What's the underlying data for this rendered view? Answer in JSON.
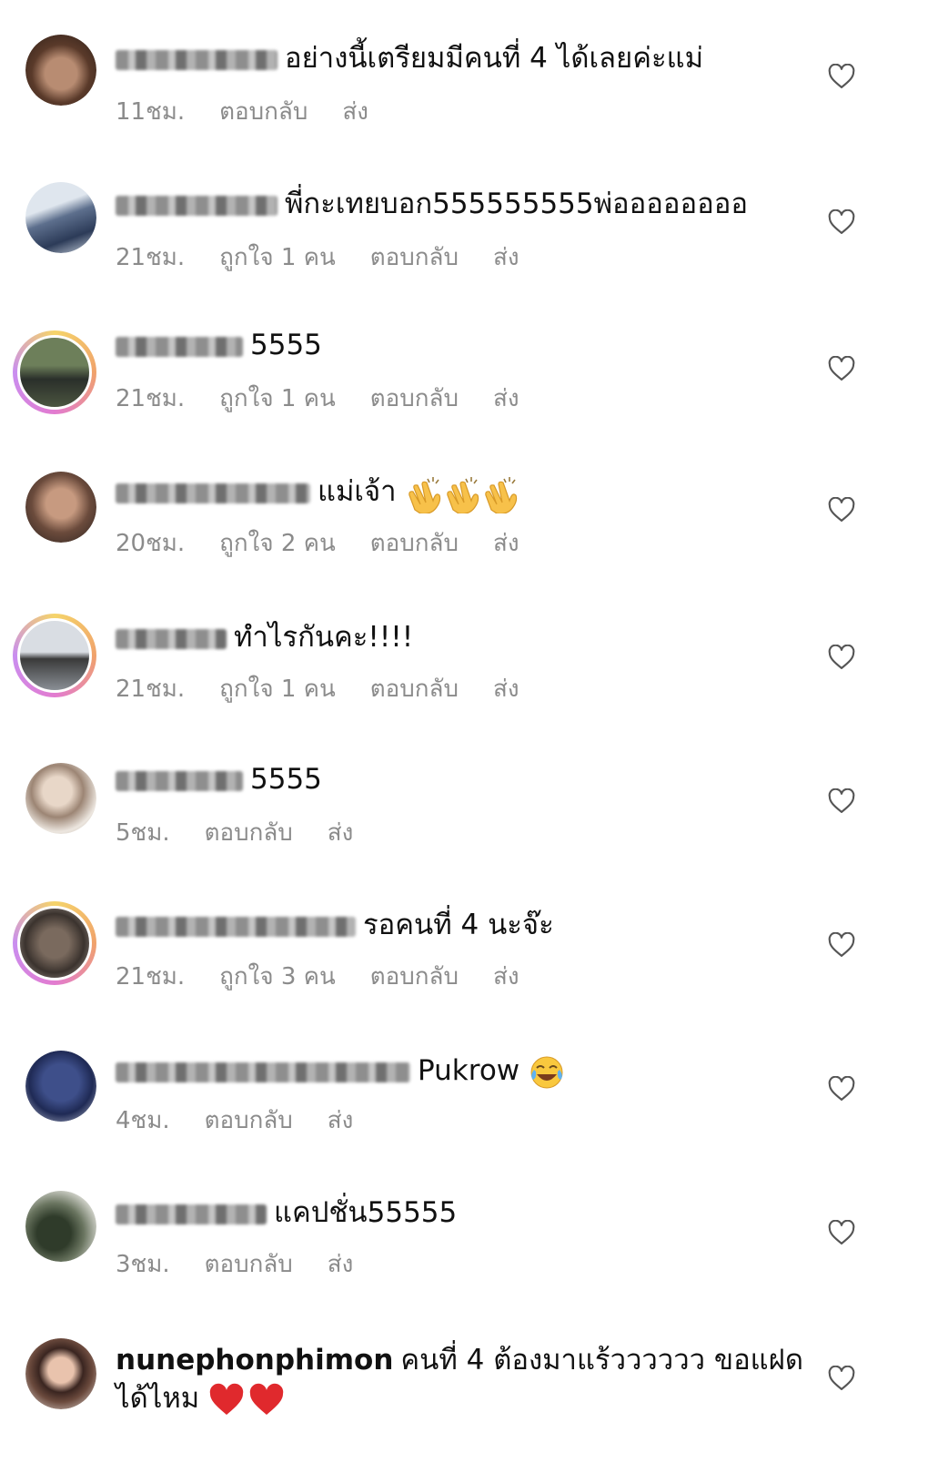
{
  "comments": [
    {
      "text": "อย่างนี้เตรียมมีคนที่ 4 ได้เลยค่ะแม่",
      "time": "11ชม.",
      "likes": "",
      "reply": "ตอบกลับ",
      "send": "ส่ง"
    },
    {
      "text": "พี่กะเทยบอก555555555พ่ออออออออ",
      "time": "21ชม.",
      "likes": "ถูกใจ 1 คน",
      "reply": "ตอบกลับ",
      "send": "ส่ง"
    },
    {
      "text": "5555",
      "time": "21ชม.",
      "likes": "ถูกใจ 1 คน",
      "reply": "ตอบกลับ",
      "send": "ส่ง"
    },
    {
      "text": "แม่เจ้า",
      "time": "20ชม.",
      "likes": "ถูกใจ 2 คน",
      "reply": "ตอบกลับ",
      "send": "ส่ง"
    },
    {
      "text": "ทำไรกันคะ!!!!",
      "time": "21ชม.",
      "likes": "ถูกใจ 1 คน",
      "reply": "ตอบกลับ",
      "send": "ส่ง"
    },
    {
      "text": "5555",
      "time": "5ชม.",
      "likes": "",
      "reply": "ตอบกลับ",
      "send": "ส่ง"
    },
    {
      "text": "รอคนที่ 4 นะจ๊ะ",
      "time": "21ชม.",
      "likes": "ถูกใจ 3 คน",
      "reply": "ตอบกลับ",
      "send": "ส่ง"
    },
    {
      "text": "Pukrow",
      "time": "4ชม.",
      "likes": "",
      "reply": "ตอบกลับ",
      "send": "ส่ง"
    },
    {
      "text": "แคปชั่น55555",
      "time": "3ชม.",
      "likes": "",
      "reply": "ตอบกลับ",
      "send": "ส่ง"
    }
  ],
  "last_comment": {
    "username": "nunephonphimon",
    "text_line1": "คนที่ 4 ต้องมาแร้วววววว  ขอแฝด",
    "text_line2": "ได้ไหม"
  },
  "icons": {
    "like": "heart-outline-icon",
    "clap": "clapping-hands-emoji",
    "laugh": "tears-of-joy-emoji",
    "love": "red-heart-emoji"
  },
  "colors": {
    "meta": "#8b8b8b",
    "text": "#111111",
    "heart_emoji": "#e0292d",
    "story_ring": "#e27bd0"
  }
}
